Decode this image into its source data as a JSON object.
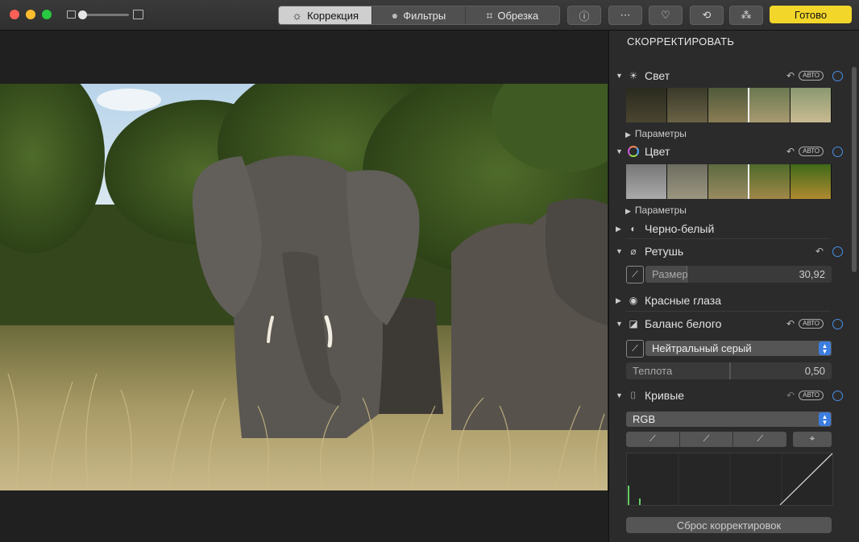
{
  "toolbar": {
    "tabs": [
      {
        "label": "Коррекция",
        "icon": "adjust-icon",
        "active": true
      },
      {
        "label": "Фильтры",
        "icon": "filters-icon",
        "active": false
      },
      {
        "label": "Обрезка",
        "icon": "crop-icon",
        "active": false
      }
    ],
    "done_label": "Готово",
    "colors": {
      "accent": "#f3d62a",
      "toggle_blue": "#4a8fe8"
    }
  },
  "panel": {
    "title": "СКОРРЕКТИРОВАТЬ",
    "light": {
      "label": "Свет",
      "auto": "АВТО",
      "params": "Параметры"
    },
    "color": {
      "label": "Цвет",
      "auto": "АВТО",
      "params": "Параметры"
    },
    "bw": {
      "label": "Черно-белый"
    },
    "retouch": {
      "label": "Ретушь",
      "size_label": "Размер",
      "size_value": "30,92",
      "size_level": 0.22
    },
    "redeye": {
      "label": "Красные глаза"
    },
    "wb": {
      "label": "Баланс белого",
      "auto": "АВТО",
      "mode": "Нейтральный серый",
      "warmth_label": "Теплота",
      "warmth_value": "0,50",
      "warmth_level": 0.5
    },
    "curves": {
      "label": "Кривые",
      "auto": "АВТО",
      "channel": "RGB"
    },
    "reset_label": "Сброс корректировок"
  }
}
